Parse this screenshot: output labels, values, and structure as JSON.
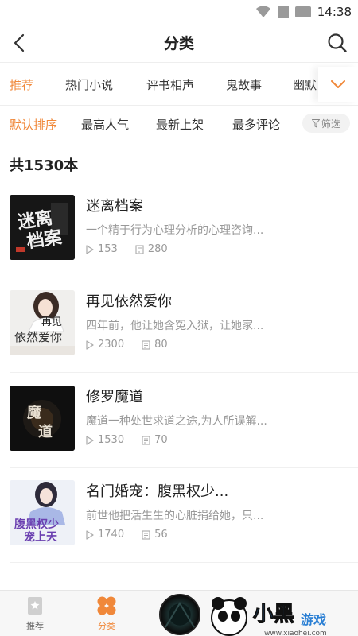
{
  "status": {
    "time": "14:38"
  },
  "nav": {
    "title": "分类"
  },
  "category_tabs": [
    {
      "label": "推荐",
      "active": true
    },
    {
      "label": "热门小说",
      "active": false
    },
    {
      "label": "评书相声",
      "active": false
    },
    {
      "label": "鬼故事",
      "active": false
    },
    {
      "label": "幽默",
      "active": false
    }
  ],
  "sort_options": [
    {
      "label": "默认排序",
      "active": true
    },
    {
      "label": "最高人气",
      "active": false
    },
    {
      "label": "最新上架",
      "active": false
    },
    {
      "label": "最多评论",
      "active": false
    }
  ],
  "filter": {
    "label": "筛选"
  },
  "result_count": "共1530本",
  "books": [
    {
      "title": "迷离档案",
      "desc": "一个精于行为心理分析的心理咨询...",
      "plays": "153",
      "chapters": "280",
      "cover_text": "迷离档案"
    },
    {
      "title": "再见依然爱你",
      "desc": "四年前，他让她含冤入狱，让她家...",
      "plays": "2300",
      "chapters": "80",
      "cover_text": "再见依然爱你"
    },
    {
      "title": "修罗魔道",
      "desc": "魔道一种处世求道之途,为人所误解...",
      "plays": "1530",
      "chapters": "70",
      "cover_text": "魔道"
    },
    {
      "title": "名门婚宠：腹黑权少...",
      "desc": "前世他把活生生的心脏捐给她，只...",
      "plays": "1740",
      "chapters": "56",
      "cover_text": "腹黑权少宠上天"
    }
  ],
  "bottom_tabs": [
    {
      "label": "推荐",
      "active": false
    },
    {
      "label": "分类",
      "active": true
    }
  ],
  "watermark": {
    "brand": "小黑游戏",
    "url": "www.xiaohei.com"
  },
  "colors": {
    "accent": "#f0883a",
    "text": "#333333",
    "muted": "#999999"
  }
}
